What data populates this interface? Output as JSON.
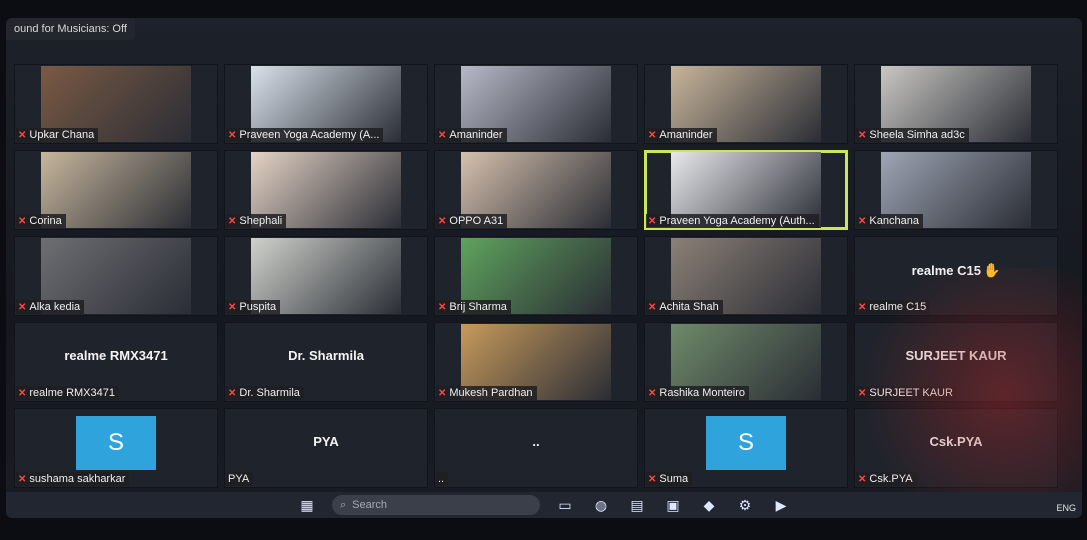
{
  "topbar": {
    "text": "ound for Musicians: Off"
  },
  "tiles": [
    {
      "row": 0,
      "col": 0,
      "name": "Upkar Chana",
      "kind": "video",
      "color": "#7a5a44"
    },
    {
      "row": 0,
      "col": 1,
      "name": "Praveen Yoga Academy (A...",
      "kind": "video",
      "color": "#d9e1ea"
    },
    {
      "row": 0,
      "col": 2,
      "name": "Amaninder",
      "kind": "video",
      "color": "#b7b9c7"
    },
    {
      "row": 0,
      "col": 3,
      "name": "Amaninder",
      "kind": "video",
      "color": "#c8b59a"
    },
    {
      "row": 0,
      "col": 4,
      "name": "Sheela Simha ad3c",
      "kind": "video",
      "color": "#c9c7c3"
    },
    {
      "row": 1,
      "col": 0,
      "name": "Corina",
      "kind": "video",
      "color": "#c7b69c"
    },
    {
      "row": 1,
      "col": 1,
      "name": "Shephali",
      "kind": "video",
      "color": "#e5d3c5"
    },
    {
      "row": 1,
      "col": 2,
      "name": "OPPO A31",
      "kind": "video",
      "color": "#d6c1ad"
    },
    {
      "row": 1,
      "col": 3,
      "name": "Praveen Yoga Academy (Auth...",
      "kind": "video",
      "color": "#e7e9ec",
      "active": true
    },
    {
      "row": 1,
      "col": 4,
      "name": "Kanchana",
      "kind": "video",
      "color": "#9ea5b4"
    },
    {
      "row": 2,
      "col": 0,
      "name": "Alka kedia",
      "kind": "video",
      "color": "#6d6f73"
    },
    {
      "row": 2,
      "col": 1,
      "name": "Puspita",
      "kind": "video",
      "color": "#cfd2cb"
    },
    {
      "row": 2,
      "col": 2,
      "name": "Brij Sharma",
      "kind": "video",
      "color": "#5fa35d"
    },
    {
      "row": 2,
      "col": 3,
      "name": "Achita Shah",
      "kind": "video",
      "color": "#8c8076"
    },
    {
      "row": 2,
      "col": 4,
      "name": "realme C15",
      "kind": "name",
      "big": "realme C15",
      "hand": true
    },
    {
      "row": 3,
      "col": 0,
      "name": "realme RMX3471",
      "kind": "name",
      "big": "realme RMX3471"
    },
    {
      "row": 3,
      "col": 1,
      "name": "Dr. Sharmila",
      "kind": "name",
      "big": "Dr. Sharmila"
    },
    {
      "row": 3,
      "col": 2,
      "name": "Mukesh Pardhan",
      "kind": "video",
      "color": "#c79a5c"
    },
    {
      "row": 3,
      "col": 3,
      "name": "Rashika Monteiro",
      "kind": "video",
      "color": "#6f8a6a"
    },
    {
      "row": 3,
      "col": 4,
      "name": "SURJEET KAUR",
      "kind": "name",
      "big": "SURJEET KAUR"
    },
    {
      "row": 4,
      "col": 0,
      "name": "sushama sakharkar",
      "kind": "avatar",
      "letter": "S"
    },
    {
      "row": 4,
      "col": 1,
      "name": "PYA",
      "kind": "name",
      "big": "PYA",
      "nomic": true
    },
    {
      "row": 4,
      "col": 2,
      "name": "..",
      "kind": "name",
      "big": "..",
      "nomic": true
    },
    {
      "row": 4,
      "col": 3,
      "name": "Suma",
      "kind": "avatar",
      "letter": "S"
    },
    {
      "row": 4,
      "col": 4,
      "name": "Csk.PYA",
      "kind": "name",
      "big": "Csk.PYA"
    }
  ],
  "taskbar": {
    "search_placeholder": "Search",
    "tray_text": "ENG"
  }
}
